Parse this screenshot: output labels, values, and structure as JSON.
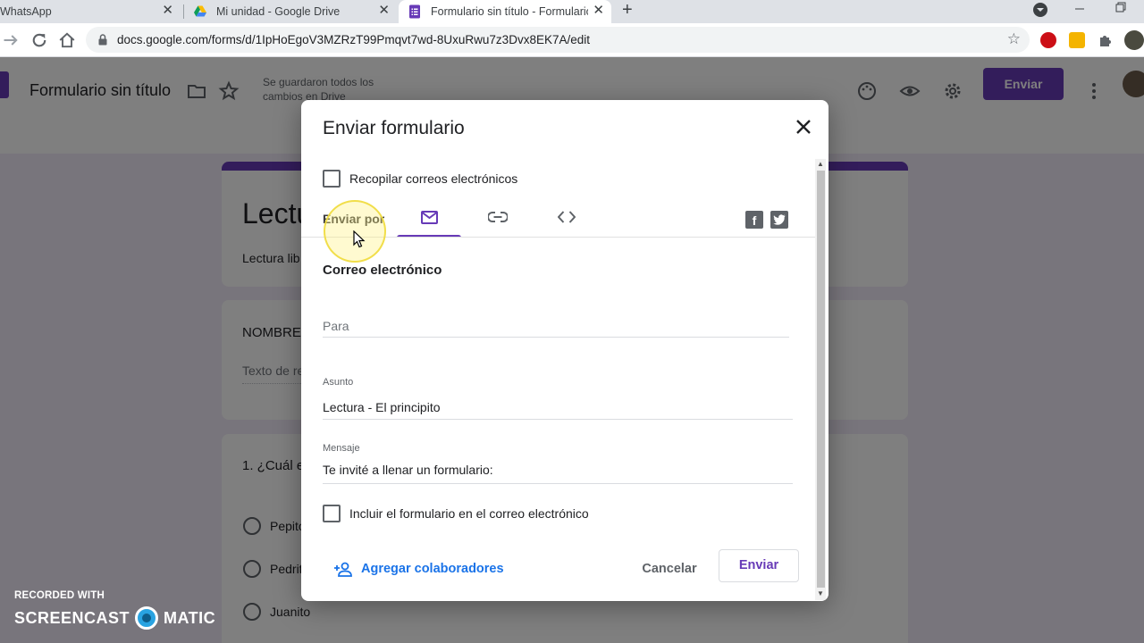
{
  "browser": {
    "tabs": [
      {
        "title": "WhatsApp",
        "close": "✕"
      },
      {
        "title": "Mi unidad - Google Drive",
        "close": "✕"
      },
      {
        "title": "Formulario sin título - Formulario",
        "close": "✕"
      }
    ],
    "new_tab": "+",
    "url": "docs.google.com/forms/d/1IpHoEgoV3MZRzT99Pmqvt7wd-8UxuRwu7z3Dvx8EK7A/edit"
  },
  "forms": {
    "title": "Formulario sin título",
    "saved_status": "Se guardaron todos los cambios en Drive",
    "send_label": "Enviar",
    "card_title_partial": "Lectu",
    "card_desc_partial": "Lectura lib",
    "name_question_partial": "NOMBRE",
    "answer_hint_partial": "Texto de re",
    "question_partial": "1. ¿Cuál e",
    "options": [
      "Pepito",
      "Pedrit",
      "Juanito"
    ]
  },
  "dialog": {
    "title": "Enviar formulario",
    "collect_emails_label": "Recopilar correos electrónicos",
    "collect_emails_checked": false,
    "send_via_label": "Enviar por",
    "send_via_tabs": [
      "email",
      "link",
      "embed"
    ],
    "active_tab": "email",
    "section_title": "Correo electrónico",
    "to_placeholder": "Para",
    "subject_label": "Asunto",
    "subject_value": "Lectura - El principito",
    "message_label": "Mensaje",
    "message_value": "Te invité a llenar un formulario:",
    "include_form_label": "Incluir el formulario en el correo electrónico",
    "include_form_checked": false,
    "add_collaborators": "Agregar colaboradores",
    "cancel": "Cancelar",
    "send": "Enviar"
  },
  "watermark": {
    "line1": "RECORDED WITH",
    "word1": "SCREENCAST",
    "word2": "MATIC"
  },
  "colors": {
    "accent": "#673ab7",
    "link_blue": "#1a73e8"
  }
}
